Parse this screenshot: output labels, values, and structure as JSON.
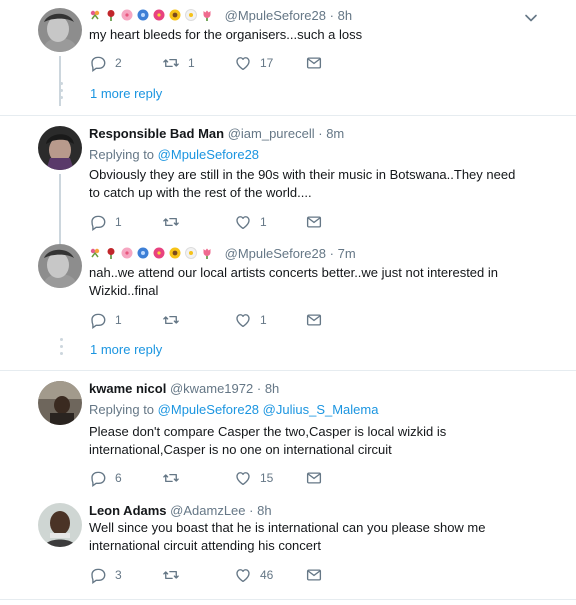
{
  "tweets": [
    {
      "emoji_names": [
        "bouquet-emoji",
        "rose-emoji",
        "cherry-blossom-emoji",
        "blue-flower-emoji",
        "hibiscus-emoji",
        "sunflower-emoji",
        "daisy-emoji",
        "tulip-emoji"
      ],
      "handle": "@MpuleSefore28",
      "dot": "·",
      "time": "8h",
      "text": "my heart bleeds for the organisers...such a loss",
      "replies": "2",
      "retweets": "1",
      "likes": "17",
      "more_reply": "1 more reply"
    },
    {
      "name": "Responsible Bad Man",
      "handle": "@iam_purecell",
      "dot": "·",
      "time": "8m",
      "replying_prefix": "Replying to",
      "replying_to": "@MpuleSefore28",
      "text": "Obviously they are still in the 90s with their music in Botswana..They need to catch up with the rest of the world....",
      "replies": "1",
      "retweets": "",
      "likes": "1"
    },
    {
      "handle": "@MpuleSefore28",
      "dot": "·",
      "time": "7m",
      "text": "nah..we attend our local artists concerts better..we just not interested in Wizkid..final",
      "replies": "1",
      "retweets": "",
      "likes": "1",
      "more_reply": "1 more reply"
    },
    {
      "name": "kwame nicol",
      "handle": "@kwame1972",
      "dot": "·",
      "time": "8h",
      "replying_prefix": "Replying to",
      "replying_to": "@MpuleSefore28 @Julius_S_Malema",
      "text": "Please don't compare Casper the two,Casper is local wizkid is international,Casper is no one on international circuit",
      "replies": "6",
      "retweets": "",
      "likes": "15"
    },
    {
      "name": "Leon Adams",
      "handle": "@AdamzLee",
      "dot": "·",
      "time": "8h",
      "text": "Well since you boast that he is international can you please show me international circuit attending his concert",
      "replies": "3",
      "retweets": "",
      "likes": "46"
    }
  ],
  "colors": {
    "link": "#1b95e0",
    "muted": "#657786",
    "text": "#14171a",
    "divider": "#e6ecf0"
  }
}
